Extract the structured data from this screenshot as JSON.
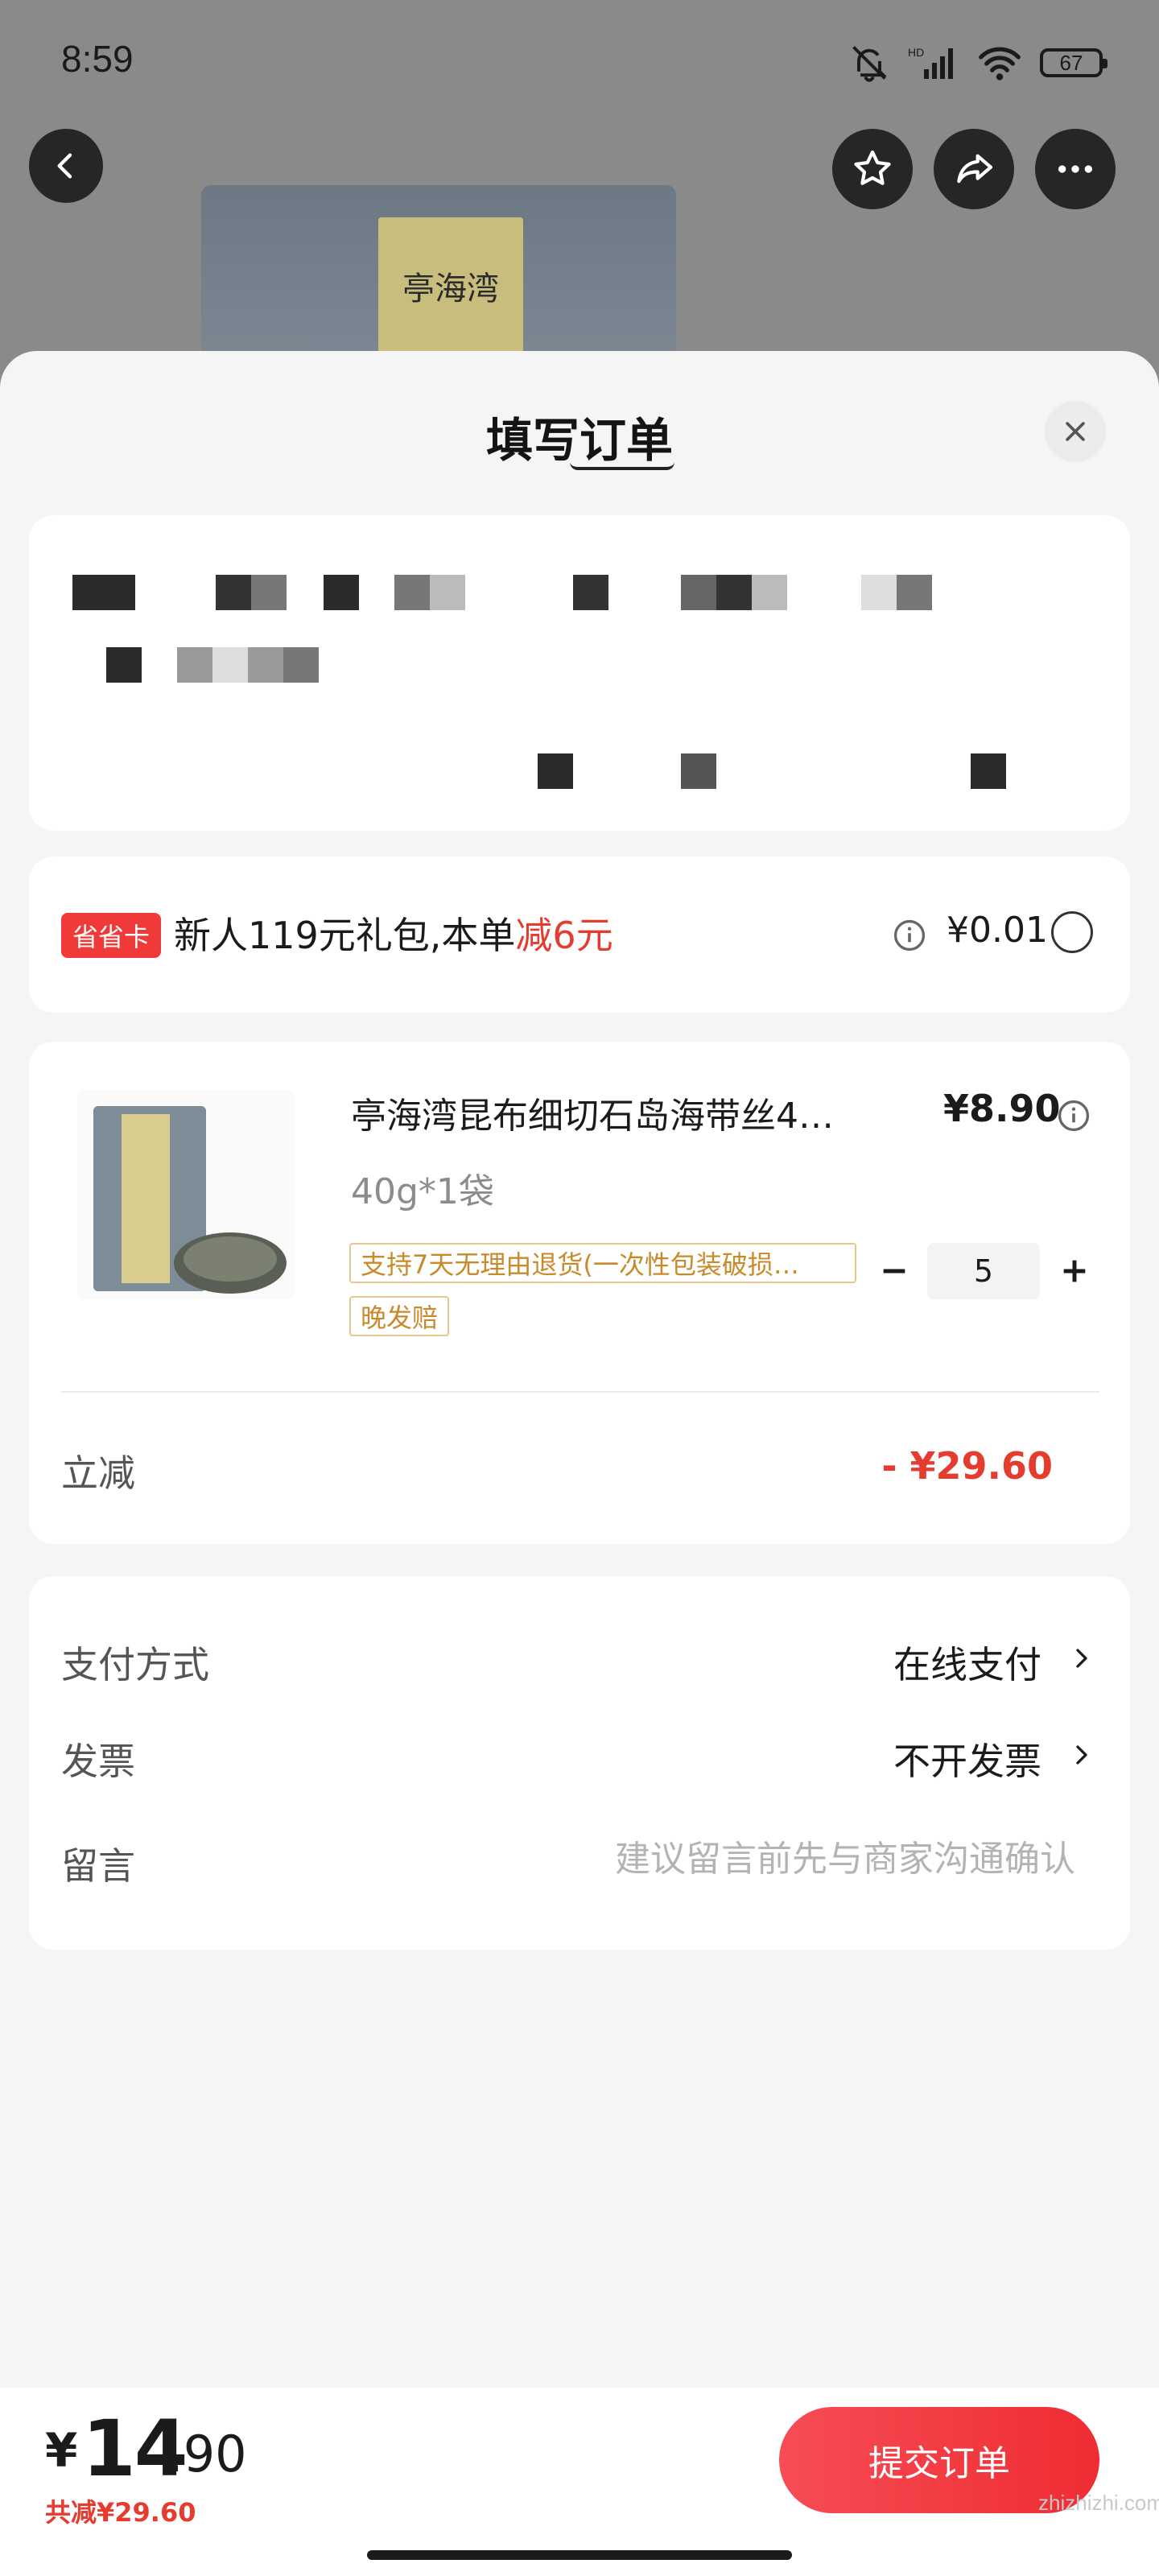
{
  "status_bar": {
    "time": "8:59",
    "battery": "67",
    "network": "HD"
  },
  "header_actions": {
    "back_icon": "chevron-left-icon",
    "favorite_icon": "star-icon",
    "share_icon": "share-icon",
    "more_icon": "more-dots-icon"
  },
  "background": {
    "photo_label_text": "亭海湾"
  },
  "sheet": {
    "title": "填写订单",
    "close_icon": "close-icon"
  },
  "promo": {
    "tag": "省省卡",
    "text_prefix": "新人119元礼包,本单",
    "text_highlight": "减6元",
    "price": "¥0.01",
    "info_icon": "info-icon"
  },
  "product": {
    "name": "亭海湾昆布细切石岛海带丝4…",
    "spec": "40g*1袋",
    "price": "¥8.90",
    "return_tag": "支持7天无理由退货(一次性包装破损…",
    "late_tag": "晚发赔",
    "quantity": "5",
    "discount_label": "立减",
    "discount_value": "- ¥29.60"
  },
  "options": {
    "payment_label": "支付方式",
    "payment_value": "在线支付",
    "invoice_label": "发票",
    "invoice_value": "不开发票",
    "memo_label": "留言",
    "memo_placeholder": "建议留言前先与商家沟通确认"
  },
  "bottom": {
    "currency": "¥",
    "total_int": "14",
    "total_dec": ".90",
    "saved": "共减¥29.60",
    "submit": "提交订单",
    "watermark": "zhizhizhi.com"
  },
  "colors": {
    "accent_red": "#e63b2f",
    "submit_red": "#ef2c33",
    "tag_orange": "#c98a2c"
  }
}
